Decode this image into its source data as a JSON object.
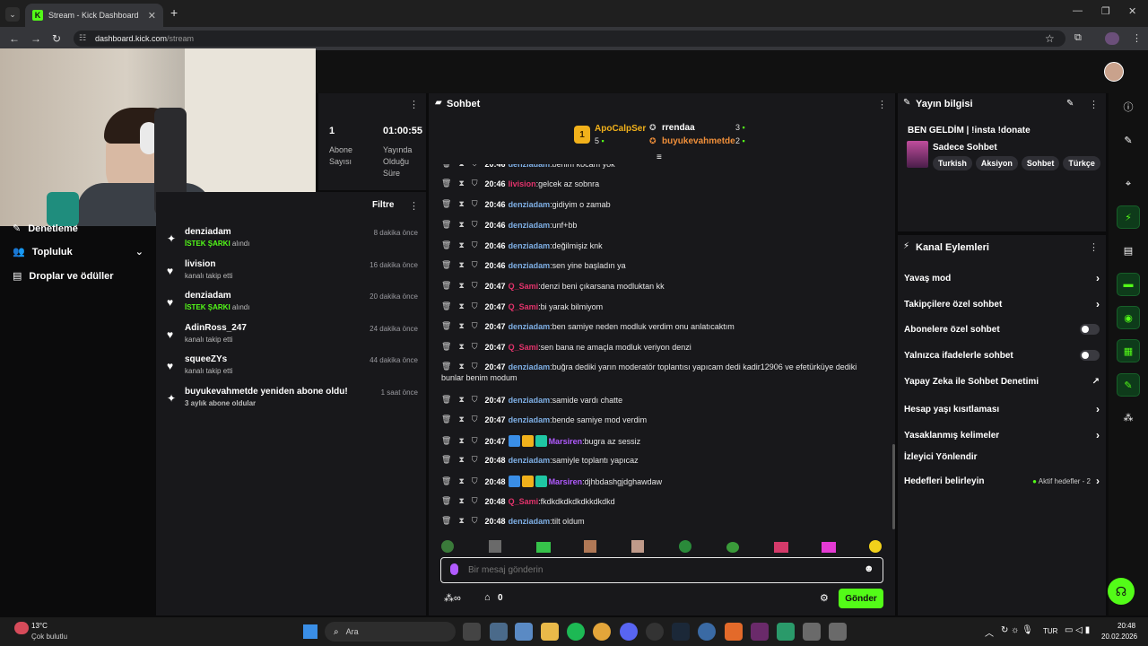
{
  "browser": {
    "tab_title": "Stream - Kick Dashboard",
    "url_host": "dashboard.kick.com",
    "url_path": "/stream",
    "favicon_letter": "K",
    "new_tab": "+",
    "tab_close": "✕"
  },
  "stats": {
    "subscriber_value": "1",
    "subscriber_label": "Abone Sayısı",
    "uptime_value": "01:00:55",
    "uptime_label": "Yayında Olduğu Süre"
  },
  "activity": {
    "filter_label": "Filtre",
    "items": [
      {
        "name": "denziadam",
        "sub": "İSTEK ŞARKI alındı",
        "sub_highlight": "İSTEK ŞARKI",
        "sub_rest": " alındı",
        "time": "8 dakika önce"
      },
      {
        "name": "livision",
        "sub": "kanalı takip etti",
        "time": "16 dakika önce"
      },
      {
        "name": "denziadam",
        "sub_highlight": "İSTEK ŞARKI",
        "sub_rest": " alındı",
        "time": "20 dakika önce"
      },
      {
        "name": "AdinRoss_247",
        "sub": "kanalı takip etti",
        "time": "24 dakika önce"
      },
      {
        "name": "squeeZYs",
        "sub": "kanalı takip etti",
        "time": "44 dakika önce"
      },
      {
        "name": "buyukevahmetde yeniden abone oldu!",
        "sub_highlight": "3 aylık abone oldular",
        "time": "1 saat önce"
      }
    ]
  },
  "sidenav": {
    "moderation": "Denetleme",
    "community": "Topluluk",
    "drops": "Droplar ve ödüller"
  },
  "chat": {
    "title": "Sohbet",
    "top_gifters": [
      {
        "rank": "1",
        "name": "ApoCalpSer",
        "count": "5"
      },
      {
        "name": "rrendaa",
        "count": "3"
      },
      {
        "name": "buyukevahmetde",
        "count": "2"
      }
    ],
    "messages": [
      {
        "time": "20:46",
        "user": "denziadam",
        "color": "blue",
        "text": "benim kocam yok"
      },
      {
        "time": "20:46",
        "user": "livision",
        "color": "red",
        "text": "gelcek az sobnra"
      },
      {
        "time": "20:46",
        "user": "denziadam",
        "color": "blue",
        "text": "gidiyim o zamab"
      },
      {
        "time": "20:46",
        "user": "denziadam",
        "color": "blue",
        "text": "unf+bb"
      },
      {
        "time": "20:46",
        "user": "denziadam",
        "color": "blue",
        "text": "değilmişiz knk"
      },
      {
        "time": "20:46",
        "user": "denziadam",
        "color": "blue",
        "text": "sen yine başladın ya"
      },
      {
        "time": "20:47",
        "user": "Q_Sami",
        "color": "red",
        "text": "denzi beni çıkarsana modluktan kk"
      },
      {
        "time": "20:47",
        "user": "Q_Sami",
        "color": "red",
        "text": "bi yarak bilmiyom"
      },
      {
        "time": "20:47",
        "user": "denziadam",
        "color": "blue",
        "text": "ben samiye neden modluk verdim onu anlatıcaktım"
      },
      {
        "time": "20:47",
        "user": "Q_Sami",
        "color": "red",
        "text": "sen bana ne amaçla modluk veriyon denzi"
      },
      {
        "time": "20:47",
        "user": "denziadam",
        "color": "blue",
        "text": "buğra dediki yarın moderatör toplantısı yapıcam dedi kadir12906 ve efetürküye dediki",
        "text2": "bunlar benim modum"
      },
      {
        "time": "20:47",
        "user": "denziadam",
        "color": "blue",
        "text": "samide vardı chatte"
      },
      {
        "time": "20:47",
        "user": "denziadam",
        "color": "blue",
        "text": "bende samiye mod verdim"
      },
      {
        "time": "20:47",
        "user": "Marsiren",
        "color": "purple",
        "badges": true,
        "text": "bugra az sessiz"
      },
      {
        "time": "20:48",
        "user": "denziadam",
        "color": "blue",
        "text": "samiyle toplantı yapıcaz"
      },
      {
        "time": "20:48",
        "user": "Marsiren",
        "color": "purple",
        "badges": true,
        "text": "djhbdashgjdghawdaw"
      },
      {
        "time": "20:48",
        "user": "Q_Sami",
        "color": "red",
        "text": "fkdkdkdkdkdkkdkdkd"
      },
      {
        "time": "20:48",
        "user": "denziadam",
        "color": "blue",
        "text": "tilt oldum"
      }
    ],
    "input_placeholder": "Bir mesaj gönderin",
    "points_count": "0",
    "send_label": "Gönder"
  },
  "stream_info": {
    "title": "Yayın bilgisi",
    "stream_title": "BEN GELDİM | !insta !donate",
    "category": "Sadece Sohbet",
    "tags": [
      "Turkish",
      "Aksiyon",
      "Sohbet",
      "Türkçe"
    ]
  },
  "channel_actions": {
    "title": "Kanal Eylemleri",
    "items": [
      {
        "label": "Yavaş mod",
        "kind": "chevron"
      },
      {
        "label": "Takipçilere özel sohbet",
        "kind": "chevron"
      },
      {
        "label": "Abonelere özel sohbet",
        "kind": "toggle"
      },
      {
        "label": "Yalnızca ifadelerle sohbet",
        "kind": "toggle"
      },
      {
        "label": "Yapay Zeka ile Sohbet Denetimi",
        "kind": "external"
      },
      {
        "label": "Hesap yaşı kısıtlaması",
        "kind": "chevron"
      },
      {
        "label": "Yasaklanmış kelimeler",
        "kind": "chevron"
      },
      {
        "label": "İzleyici Yönlendir",
        "kind": "none"
      },
      {
        "label": "Hedefleri belirleyin",
        "kind": "chevron",
        "extra": "Aktif hedefler - 2"
      }
    ]
  },
  "taskbar": {
    "weather_temp": "13°C",
    "weather_desc": "Çok bulutlu",
    "search": "Ara",
    "lang": "TUR",
    "time": "20:48",
    "date": "20.02.2026"
  },
  "colors": {
    "accent": "#53fc18",
    "panel": "#18181b",
    "bg": "#0b0b0c"
  }
}
